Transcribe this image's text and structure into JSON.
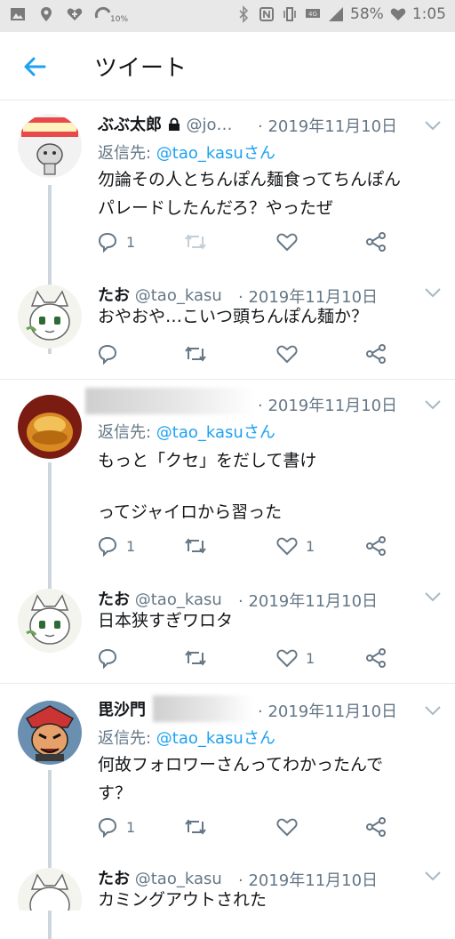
{
  "status": {
    "battery": "58%",
    "time": "1:05",
    "net_speed": "10%"
  },
  "header": {
    "title": "ツイート"
  },
  "tweets": [
    {
      "name": "ぶぶ太郎",
      "handle": "@jo…",
      "date": "· 2019年11月10日",
      "reply_prefix": "返信先: ",
      "reply_user": "@tao_kasuさん",
      "line1": "勿論その人とちんぽん麺食ってちんぽん",
      "line2": "パレードしたんだろ？やったぜ",
      "line3": "",
      "replies": "1",
      "likes": ""
    },
    {
      "name": "たお",
      "handle": "@tao_kasu",
      "date": "· 2019年11月10日",
      "line1": "おやおや…こいつ頭ちんぽん麺か？",
      "replies": "",
      "likes": ""
    },
    {
      "name": "",
      "handle": "",
      "date": "· 2019年11月10日",
      "reply_prefix": "返信先: ",
      "reply_user": "@tao_kasuさん",
      "line1": "もっと「クセ」をだして書け",
      "line2": "",
      "line3": "ってジャイロから習った",
      "replies": "1",
      "likes": "1"
    },
    {
      "name": "たお",
      "handle": "@tao_kasu",
      "date": "· 2019年11月10日",
      "line1": "日本狭すぎワロタ",
      "replies": "",
      "likes": "1"
    },
    {
      "name": "毘沙門",
      "handle": "",
      "date": "· 2019年11月10日",
      "reply_prefix": "返信先: ",
      "reply_user": "@tao_kasuさん",
      "line1": "何故フォロワーさんってわかったんで",
      "line2": "す？",
      "replies": "1",
      "likes": ""
    },
    {
      "name": "たお",
      "handle": "@tao_kasu",
      "date": "· 2019年11月10日",
      "line1": "カミングアウトされた"
    }
  ],
  "colors": {
    "accent": "#1da1f2",
    "muted": "#657786",
    "divider": "#e6ecf0"
  }
}
